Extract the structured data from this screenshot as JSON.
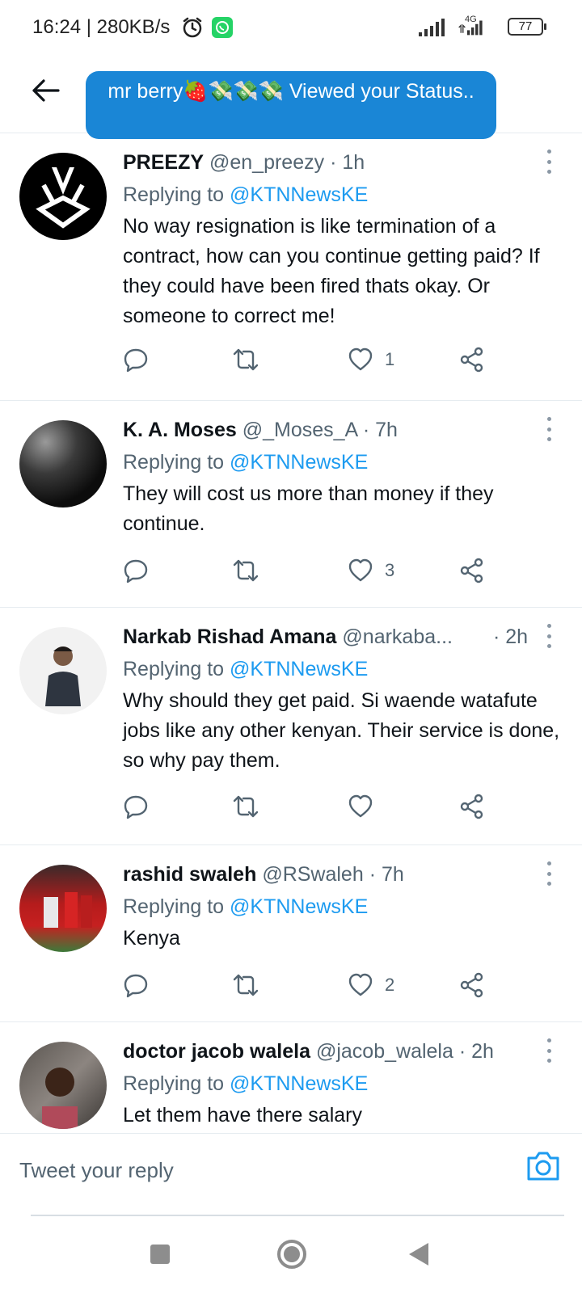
{
  "status_bar": {
    "time": "16:24 | 280KB/s",
    "network_type": "4G",
    "battery": "77",
    "icons": [
      "alarm-icon",
      "whatsapp-icon",
      "signal-icon",
      "signal-4g-icon",
      "battery-icon"
    ]
  },
  "header": {
    "back_icon": "arrow-left-icon",
    "toast": "mr berry🍓💸💸💸 Viewed your Status.."
  },
  "tweets": [
    {
      "name": "PREEZY",
      "handle": "@en_preezy",
      "time": "· 1h",
      "replying_label": "Replying to ",
      "replying_to": "@KTNNewsKE",
      "text": "No way  resignation is like termination of a contract, how can you continue getting paid? If they could have been fired thats okay. Or someone to correct me!",
      "likes": "1"
    },
    {
      "name": "K. A. Moses",
      "handle": "@_Moses_A",
      "time": "· 7h",
      "replying_label": "Replying to ",
      "replying_to": "@KTNNewsKE",
      "text": "They will cost us more than money if they continue.",
      "likes": "3"
    },
    {
      "name": "Narkab Rishad Amana",
      "handle": "@narkaba...",
      "time": "· 2h",
      "replying_label": "Replying to ",
      "replying_to": "@KTNNewsKE",
      "text": "Why should they get paid. Si waende watafute jobs like any other kenyan. Their service is done, so why pay them.",
      "likes": ""
    },
    {
      "name": "rashid swaleh",
      "handle": "@RSwaleh",
      "time": "· 7h",
      "replying_label": "Replying to ",
      "replying_to": "@KTNNewsKE",
      "text": "Kenya",
      "likes": "2"
    },
    {
      "name": "doctor jacob walela",
      "handle": "@jacob_walela",
      "time": "· 2h",
      "replying_label": "Replying to ",
      "replying_to": "@KTNNewsKE",
      "text": "Let them have there salary",
      "likes": ""
    }
  ],
  "reply_bar": {
    "placeholder": "Tweet your reply",
    "camera_icon": "camera-icon"
  },
  "nav_bar": {
    "icons": [
      "recents-square-icon",
      "home-circle-icon",
      "back-triangle-icon"
    ]
  },
  "colors": {
    "accent": "#1d9bf0",
    "toast_bg": "#1a86d6",
    "secondary_text": "#536471",
    "divider": "#e6ecf0"
  }
}
